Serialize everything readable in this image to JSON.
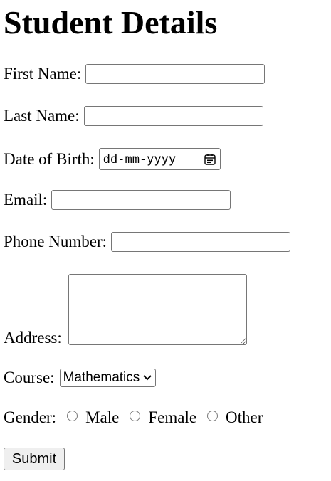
{
  "page": {
    "title": "Student Details"
  },
  "form": {
    "first_name": {
      "label": "First Name:",
      "value": ""
    },
    "last_name": {
      "label": "Last Name:",
      "value": ""
    },
    "dob": {
      "label": "Date of Birth:",
      "placeholder": "dd-mm-yyyy",
      "icon": "calendar-icon"
    },
    "email": {
      "label": "Email:",
      "value": ""
    },
    "phone": {
      "label": "Phone Number:",
      "value": ""
    },
    "address": {
      "label": "Address:",
      "value": ""
    },
    "course": {
      "label": "Course:",
      "selected": "Mathematics",
      "icon": "chevron-down-icon"
    },
    "gender": {
      "label": "Gender:",
      "options": [
        {
          "label": "Male",
          "checked": false
        },
        {
          "label": "Female",
          "checked": false
        },
        {
          "label": "Other",
          "checked": false
        }
      ]
    },
    "submit_label": "Submit"
  }
}
